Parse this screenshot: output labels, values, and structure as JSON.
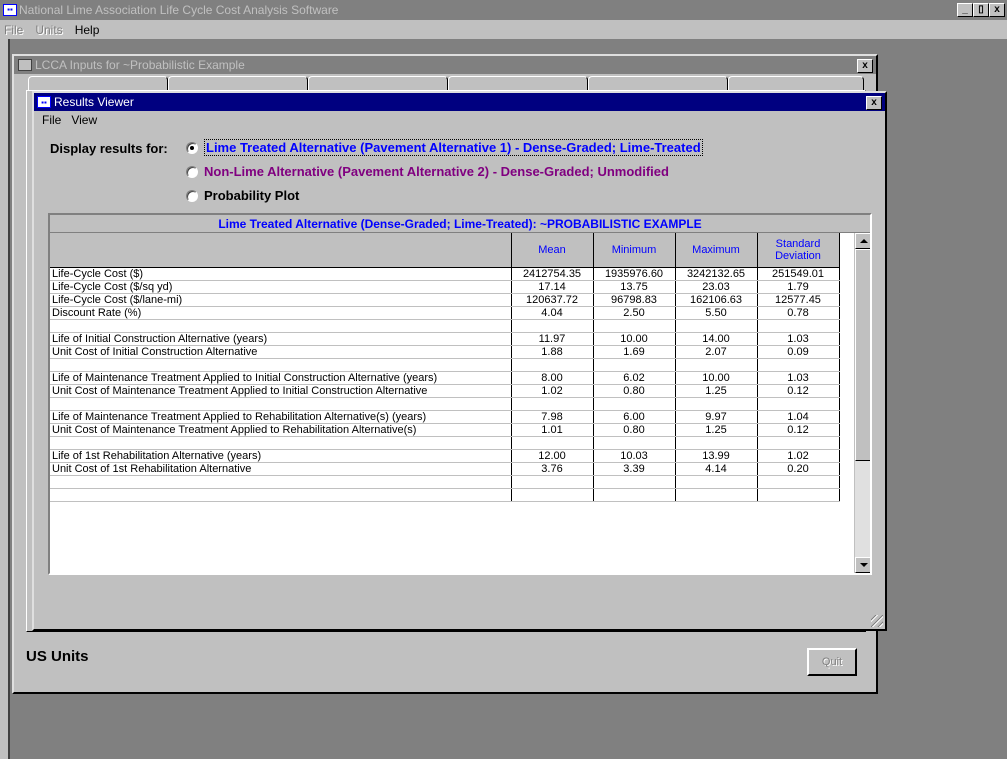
{
  "app": {
    "title": "National Lime Association Life Cycle Cost Analysis Software",
    "menu": {
      "file": "File",
      "units": "Units",
      "help": "Help"
    },
    "window_buttons": {
      "minimize": "_",
      "restore": "▯",
      "close": "x"
    }
  },
  "lcca_window": {
    "title": "LCCA Inputs for ~Probabilistic Example",
    "units_label": "US Units",
    "quit_label": "Quit"
  },
  "results_viewer": {
    "title": "Results Viewer",
    "menu": {
      "file": "File",
      "view": "View"
    },
    "display_label": "Display results for:",
    "options": [
      {
        "label": "Lime Treated Alternative (Pavement Alternative 1) - Dense-Graded; Lime-Treated",
        "selected": true
      },
      {
        "label": "Non-Lime Alternative (Pavement Alternative 2) - Dense-Graded; Unmodified",
        "selected": false
      },
      {
        "label": "Probability Plot",
        "selected": false
      }
    ],
    "grid": {
      "caption": "Lime Treated Alternative (Dense-Graded; Lime-Treated): ~PROBABILISTIC EXAMPLE",
      "headers": [
        "",
        "Mean",
        "Minimum",
        "Maximum",
        "Standard Deviation"
      ],
      "rows": [
        [
          "Life-Cycle Cost ($)",
          "2412754.35",
          "1935976.60",
          "3242132.65",
          "251549.01"
        ],
        [
          "Life-Cycle Cost ($/sq yd)",
          "17.14",
          "13.75",
          "23.03",
          "1.79"
        ],
        [
          "Life-Cycle Cost ($/lane-mi)",
          "120637.72",
          "96798.83",
          "162106.63",
          "12577.45"
        ],
        [
          "Discount Rate (%)",
          "4.04",
          "2.50",
          "5.50",
          "0.78"
        ],
        [
          "",
          "",
          "",
          "",
          ""
        ],
        [
          "Life of Initial Construction Alternative (years)",
          "11.97",
          "10.00",
          "14.00",
          "1.03"
        ],
        [
          "Unit Cost of Initial Construction Alternative",
          "1.88",
          "1.69",
          "2.07",
          "0.09"
        ],
        [
          "",
          "",
          "",
          "",
          ""
        ],
        [
          "Life of Maintenance Treatment Applied to Initial Construction Alternative (years)",
          "8.00",
          "6.02",
          "10.00",
          "1.03"
        ],
        [
          "Unit Cost of Maintenance Treatment Applied to Initial Construction Alternative",
          "1.02",
          "0.80",
          "1.25",
          "0.12"
        ],
        [
          "",
          "",
          "",
          "",
          ""
        ],
        [
          "Life of Maintenance Treatment Applied to Rehabilitation Alternative(s) (years)",
          "7.98",
          "6.00",
          "9.97",
          "1.04"
        ],
        [
          "Unit Cost of Maintenance Treatment Applied to Rehabilitation Alternative(s)",
          "1.01",
          "0.80",
          "1.25",
          "0.12"
        ],
        [
          "",
          "",
          "",
          "",
          ""
        ],
        [
          "Life of 1st Rehabilitation Alternative (years)",
          "12.00",
          "10.03",
          "13.99",
          "1.02"
        ],
        [
          "Unit Cost of 1st Rehabilitation Alternative",
          "3.76",
          "3.39",
          "4.14",
          "0.20"
        ],
        [
          "",
          "",
          "",
          "",
          ""
        ],
        [
          "",
          "",
          "",
          "",
          ""
        ]
      ]
    }
  }
}
